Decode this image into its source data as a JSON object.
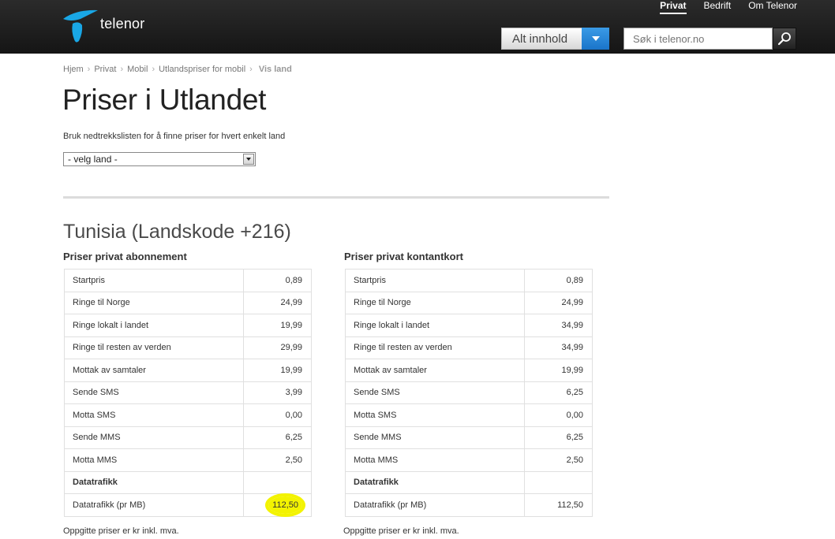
{
  "header": {
    "logo_text": "telenor",
    "nav": [
      "Privat",
      "Bedrift",
      "Om Telenor"
    ],
    "nav_active": "Privat",
    "scope_label": "Alt innhold",
    "search_placeholder": "Søk i telenor.no",
    "colors": {
      "bar": "#1b1b1b",
      "accent": "#1f82d6",
      "logo": "#19a7e6"
    }
  },
  "breadcrumb": {
    "items": [
      "Hjem",
      "Privat",
      "Mobil",
      "Utlandspriser for mobil"
    ],
    "current": "Vis land"
  },
  "page_title": "Priser i Utlandet",
  "intro_text": "Bruk nedtrekkslisten for å finne priser for hvert enkelt land",
  "country_select": {
    "value": "- velg land -"
  },
  "country_title": "Tunisia (Landskode +216)",
  "tables": [
    {
      "title": "Priser privat abonnement",
      "rows": [
        {
          "label": "Startpris",
          "value": "0,89"
        },
        {
          "label": "Ringe til Norge",
          "value": "24,99"
        },
        {
          "label": "Ringe lokalt i landet",
          "value": "19,99"
        },
        {
          "label": "Ringe til resten av verden",
          "value": "29,99"
        },
        {
          "label": "Mottak av samtaler",
          "value": "19,99"
        },
        {
          "label": "Sende SMS",
          "value": "3,99"
        },
        {
          "label": "Motta SMS",
          "value": "0,00"
        },
        {
          "label": "Sende MMS",
          "value": "6,25"
        },
        {
          "label": "Motta MMS",
          "value": "2,50"
        },
        {
          "label": "Datatrafikk",
          "value": "",
          "heading": true
        },
        {
          "label": "Datatrafikk (pr MB)",
          "value": "112,50",
          "highlight": true
        }
      ],
      "note": "Oppgitte priser er kr inkl. mva."
    },
    {
      "title": "Priser privat kontantkort",
      "rows": [
        {
          "label": "Startpris",
          "value": "0,89"
        },
        {
          "label": "Ringe til Norge",
          "value": "24,99"
        },
        {
          "label": "Ringe lokalt i landet",
          "value": "34,99"
        },
        {
          "label": "Ringe til resten av verden",
          "value": "34,99"
        },
        {
          "label": "Mottak av samtaler",
          "value": "19,99"
        },
        {
          "label": "Sende SMS",
          "value": "6,25"
        },
        {
          "label": "Motta SMS",
          "value": "0,00"
        },
        {
          "label": "Sende MMS",
          "value": "6,25"
        },
        {
          "label": "Motta MMS",
          "value": "2,50"
        },
        {
          "label": "Datatrafikk",
          "value": "",
          "heading": true
        },
        {
          "label": "Datatrafikk (pr MB)",
          "value": "112,50"
        }
      ],
      "note": "Oppgitte priser er kr inkl. mva."
    }
  ]
}
